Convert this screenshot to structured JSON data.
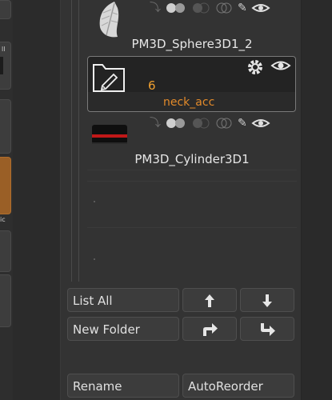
{
  "left_strip": {
    "label_top": "ll",
    "label_mid": "ic"
  },
  "subtools": [
    {
      "name": "PM3D_Sphere3D1_2"
    },
    {
      "name": "PM3D_Cylinder3D1"
    }
  ],
  "folder": {
    "count": "6",
    "name": "neck_acc"
  },
  "buttons": {
    "list_all": "List All",
    "new_folder": "New Folder",
    "rename": "Rename",
    "auto_reorder": "AutoReorder"
  },
  "colors": {
    "accent_orange": "#e28a2a",
    "left_strip_active": "#9a5f26",
    "panel_bg": "#333333"
  },
  "icons": [
    "eye-icon",
    "gear-icon",
    "brush-icon",
    "arrow-up-icon",
    "arrow-down-icon",
    "move-up-right-icon",
    "move-down-right-icon"
  ]
}
